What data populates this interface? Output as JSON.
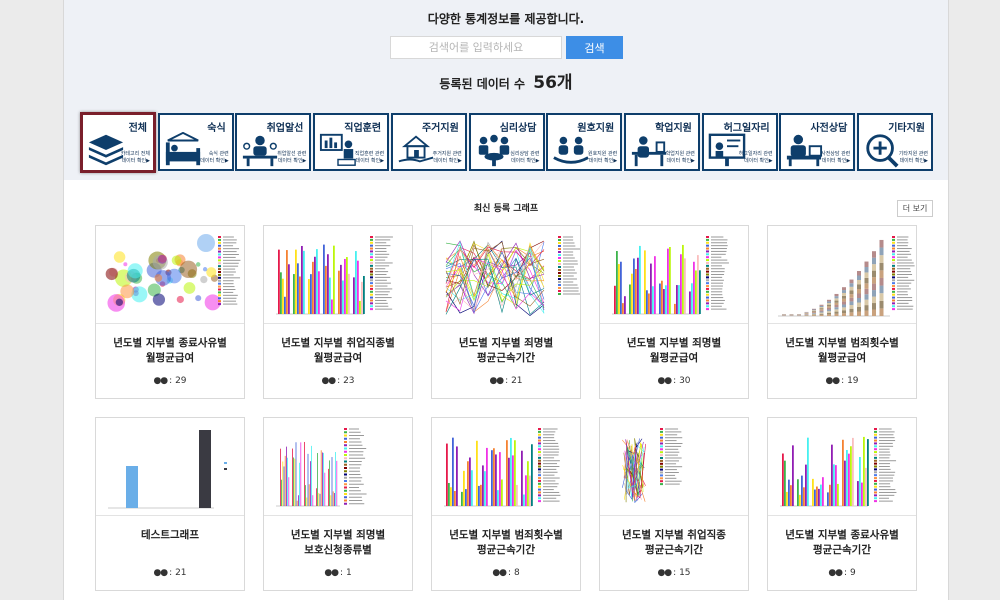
{
  "header": {
    "headline": "다양한 통계정보를 제공합니다.",
    "search_placeholder": "검색어를 입력하세요",
    "search_value": "",
    "search_button": "검색",
    "count_prefix": "등록된 데이터 수",
    "count_value": "56개"
  },
  "categories": [
    {
      "label": "전체",
      "sub": "카테고리 전체\n데이터 확인▶",
      "icon": "layers-icon",
      "active": true
    },
    {
      "label": "숙식",
      "sub": "숙식 관련\n데이터 확인▶",
      "icon": "bed-icon"
    },
    {
      "label": "취업알선",
      "sub": "취업알선 관련\n데이터 확인▶",
      "icon": "job-interview-icon"
    },
    {
      "label": "직업훈련",
      "sub": "직업훈련 관련\n데이터 확인▶",
      "icon": "presentation-icon"
    },
    {
      "label": "주거지원",
      "sub": "주거지원 관련\n데이터 확인▶",
      "icon": "house-hand-icon"
    },
    {
      "label": "심리상담",
      "sub": "심리상담 관련\n데이터 확인▶",
      "icon": "counseling-icon"
    },
    {
      "label": "원호지원",
      "sub": "원호지원 관련\n데이터 확인▶",
      "icon": "support-people-icon"
    },
    {
      "label": "학업지원",
      "sub": "학업지원 관련\n데이터 확인▶",
      "icon": "study-desk-icon"
    },
    {
      "label": "허그일자리",
      "sub": "허그일자리 관련\n데이터 확인▶",
      "icon": "whiteboard-icon"
    },
    {
      "label": "사전상담",
      "sub": "사전상담 관련\n데이터 확인▶",
      "icon": "consultation-icon"
    },
    {
      "label": "기타지원",
      "sub": "기타지원 관련\n데이터 확인▶",
      "icon": "plus-search-icon"
    }
  ],
  "section": {
    "title": "최신 등록 그래프",
    "more_button": "더 보기"
  },
  "cards": [
    {
      "title": "년도별 지부별 종료사유별\n월평균급여",
      "views": ": 29",
      "thumb": "bubble"
    },
    {
      "title": "년도별 지부별 취업직종별\n월평균급여",
      "views": ": 23",
      "thumb": "bars"
    },
    {
      "title": "년도별 지부별 죄명별\n평균근속기간",
      "views": ": 21",
      "thumb": "lines"
    },
    {
      "title": "년도별 지부별 죄명별\n월평균급여",
      "views": ": 30",
      "thumb": "bars"
    },
    {
      "title": "년도별 지부별 범죄횟수별\n월평균급여",
      "views": ": 19",
      "thumb": "stacked"
    },
    {
      "title": "테스트그래프",
      "views": ": 21",
      "thumb": "twobar"
    },
    {
      "title": "년도별 지부별 죄명별\n보호신청종류별",
      "views": ": 1",
      "thumb": "thin"
    },
    {
      "title": "년도별 지부별 범죄횟수별\n평균근속기간",
      "views": ": 8",
      "thumb": "bars"
    },
    {
      "title": "년도별 지부별 취업직종\n평균근속기간",
      "views": ": 15",
      "thumb": "scatterlines"
    },
    {
      "title": "년도별 지부별 종료사유별\n평균근속기간",
      "views": ": 9",
      "thumb": "bars"
    }
  ],
  "colors": {
    "navy": "#0e3e6b",
    "active_border": "#7a1f2b",
    "search_button": "#3d8ee6",
    "top_bg": "#eef1f6"
  }
}
